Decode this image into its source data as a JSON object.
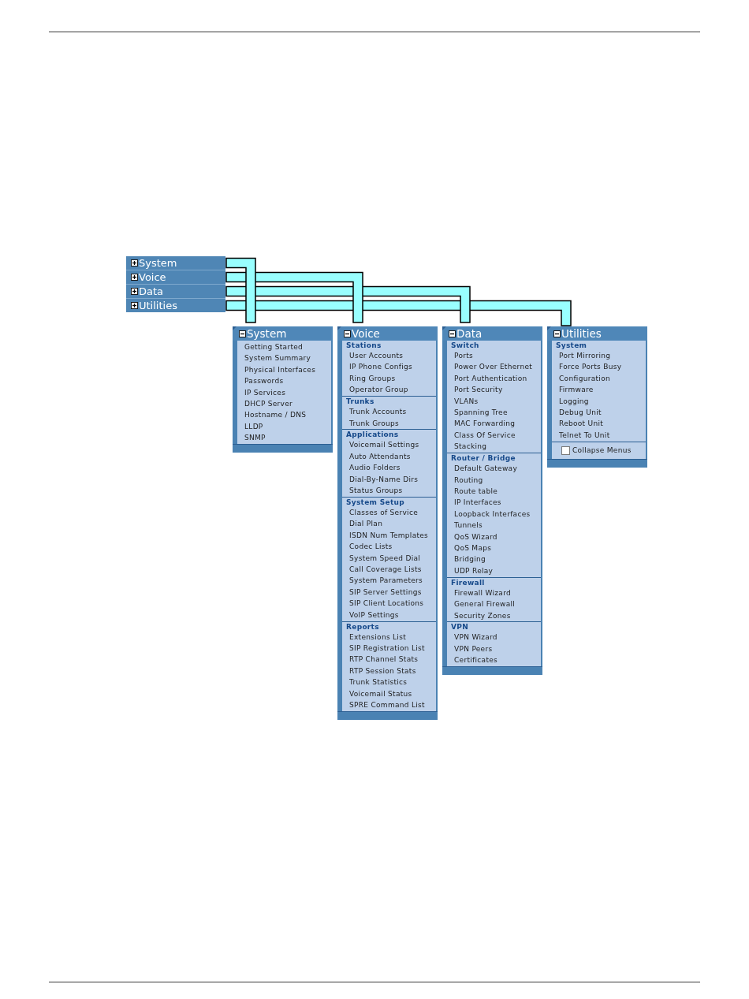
{
  "collapsed_menu": {
    "items": [
      {
        "label": "System",
        "expanded": false
      },
      {
        "label": "Voice",
        "expanded": false
      },
      {
        "label": "Data",
        "expanded": false
      },
      {
        "label": "Utilities",
        "expanded": false
      }
    ]
  },
  "panels": [
    {
      "title": "System",
      "expanded": true,
      "sections": [
        {
          "items": [
            "Getting Started",
            "System Summary",
            "Physical Interfaces",
            "Passwords",
            "IP Services",
            "DHCP Server",
            "Hostname / DNS",
            "LLDP",
            "SNMP"
          ]
        }
      ]
    },
    {
      "title": "Voice",
      "expanded": true,
      "sections": [
        {
          "heading": "Stations",
          "items": [
            "User Accounts",
            "IP Phone Configs",
            "Ring Groups",
            "Operator Group"
          ]
        },
        {
          "heading": "Trunks",
          "items": [
            "Trunk Accounts",
            "Trunk Groups"
          ]
        },
        {
          "heading": "Applications",
          "items": [
            "Voicemail Settings",
            "Auto Attendants",
            "Audio Folders",
            "Dial-By-Name Dirs",
            "Status Groups"
          ]
        },
        {
          "heading": "System Setup",
          "items": [
            "Classes of Service",
            "Dial Plan",
            "ISDN Num Templates",
            "Codec Lists",
            "System Speed Dial",
            "Call Coverage Lists",
            "System Parameters",
            "SIP Server Settings",
            "SIP Client Locations",
            "VoIP Settings"
          ]
        },
        {
          "heading": "Reports",
          "items": [
            "Extensions List",
            "SIP Registration List",
            "RTP Channel Stats",
            "RTP Session Stats",
            "Trunk Statistics",
            "Voicemail Status",
            "SPRE Command List"
          ]
        }
      ]
    },
    {
      "title": "Data",
      "expanded": true,
      "sections": [
        {
          "heading": "Switch",
          "items": [
            "Ports",
            "Power Over Ethernet",
            "Port Authentication",
            "Port Security",
            "VLANs",
            "Spanning Tree",
            "MAC Forwarding",
            "Class Of Service",
            "Stacking"
          ]
        },
        {
          "heading": "Router / Bridge",
          "items": [
            "Default Gateway",
            "Routing",
            "Route table",
            "IP Interfaces",
            "Loopback Interfaces",
            "Tunnels",
            "QoS Wizard",
            "QoS Maps",
            "Bridging",
            "UDP Relay"
          ]
        },
        {
          "heading": "Firewall",
          "items": [
            "Firewall Wizard",
            "General Firewall",
            "Security Zones"
          ]
        },
        {
          "heading": "VPN",
          "items": [
            "VPN Wizard",
            "VPN Peers",
            "Certificates"
          ]
        }
      ]
    },
    {
      "title": "Utilities",
      "expanded": true,
      "sections": [
        {
          "heading": "System",
          "items": [
            "Port Mirroring",
            "Force Ports Busy",
            "Configuration",
            "Firmware",
            "Logging",
            "Debug Unit",
            "Reboot Unit",
            "Telnet To Unit"
          ]
        }
      ],
      "option": {
        "label": "Collapse Menus",
        "checked": false
      }
    }
  ]
}
